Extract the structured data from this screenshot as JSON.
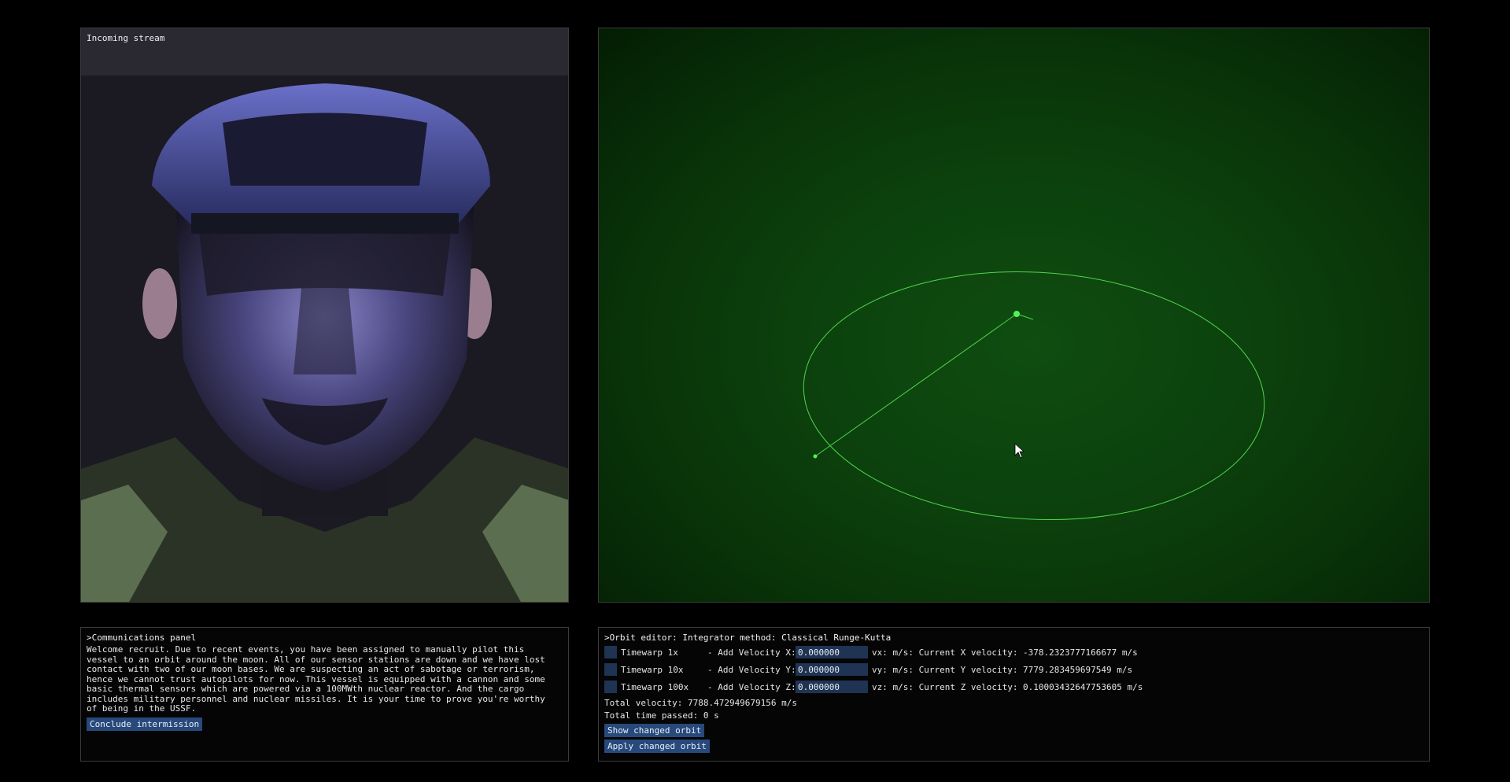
{
  "stream": {
    "title": "Incoming stream"
  },
  "comms": {
    "header": ">Communications panel",
    "message": "Welcome recruit. Due to recent events, you have been assigned to manually pilot this vessel to an orbit around the moon. All of our sensor stations are down and we have lost contact with two of our moon bases. We are suspecting an act of sabotage or terrorism, hence we cannot trust autopilots for now. This vessel is equipped with a cannon and some basic thermal sensors which are powered via a 100MWth nuclear reactor. And the cargo includes military personnel and nuclear missiles. It is your time to prove you're worthy of being in the USSF.",
    "conclude_button": "Conclude intermission"
  },
  "orbit_editor": {
    "header": ">Orbit editor: Integrator method: Classical Runge-Kutta",
    "rows": [
      {
        "timewarp": "Timewarp 1x",
        "vel_label": "- Add Velocity X:",
        "value": "0.000000",
        "unit": "vx: m/s:",
        "current": "Current X velocity: -378.2323777166677 m/s"
      },
      {
        "timewarp": "Timewarp 10x",
        "vel_label": "- Add Velocity Y:",
        "value": "0.000000",
        "unit": "vy: m/s:",
        "current": "Current Y velocity: 7779.283459697549 m/s"
      },
      {
        "timewarp": "Timewarp 100x",
        "vel_label": "- Add Velocity Z:",
        "value": "0.000000",
        "unit": "vz: m/s:",
        "current": "Current Z velocity: 0.10003432647753605 m/s"
      }
    ],
    "total_velocity": "Total velocity: 7788.472949679156 m/s",
    "total_time": "Total time passed: 0 s",
    "show_button": "Show changed orbit",
    "apply_button": "Apply changed orbit"
  },
  "colors": {
    "orbit_line": "#4fd44f",
    "button_bg": "#28497b",
    "input_bg": "#1f3353"
  },
  "icons": {
    "cursor": "mouse-pointer-icon"
  }
}
